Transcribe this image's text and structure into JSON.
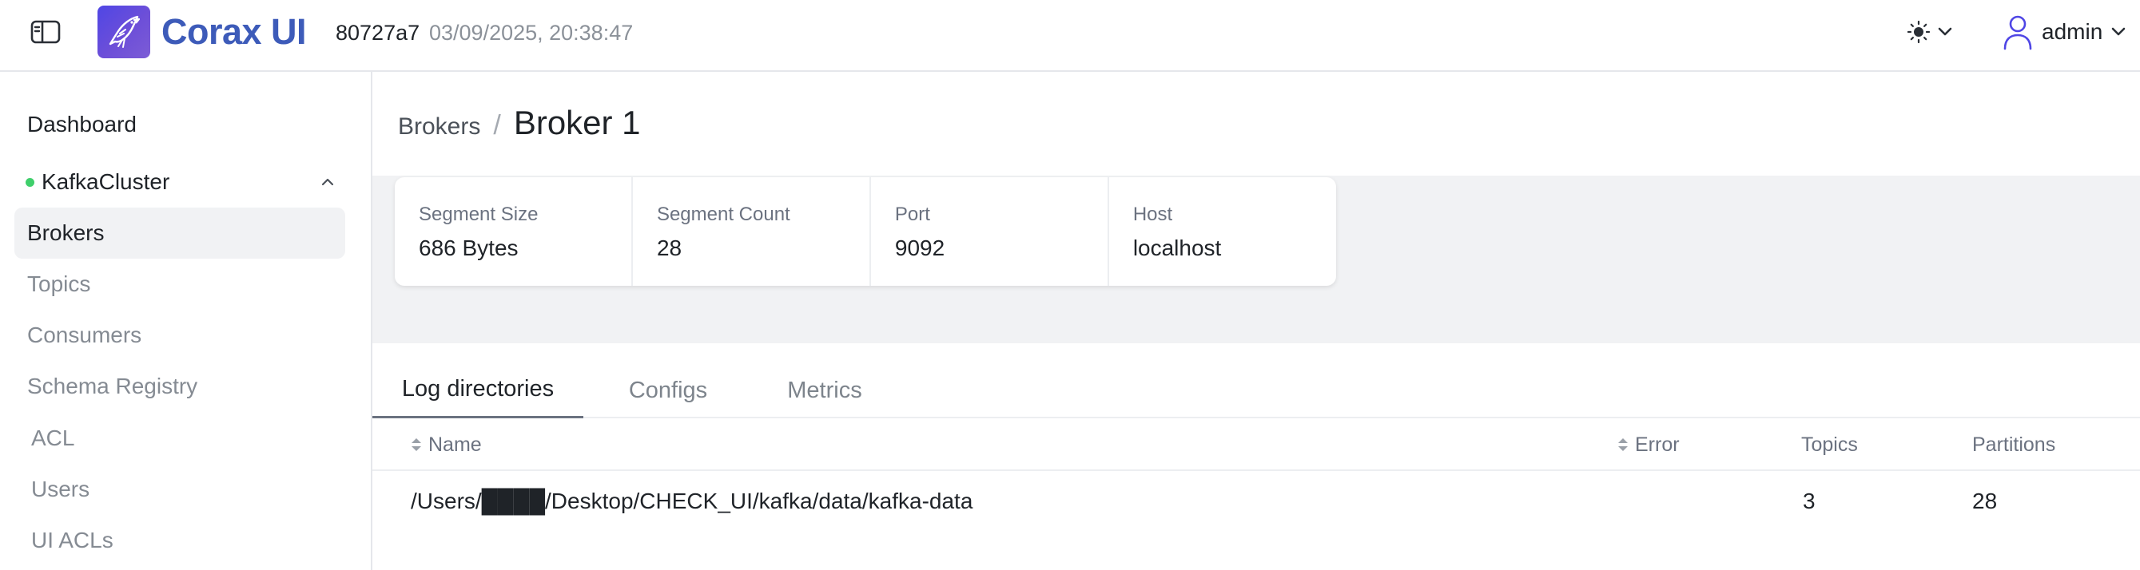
{
  "header": {
    "brand": "Corax UI",
    "build_hash": "80727a7",
    "build_date": "03/09/2025, 20:38:47",
    "user": "admin"
  },
  "sidebar": {
    "dashboard": "Dashboard",
    "cluster": {
      "name": "KafkaCluster",
      "status_color": "#3fcf6b"
    },
    "items": [
      {
        "label": "Brokers",
        "active": true
      },
      {
        "label": "Topics"
      },
      {
        "label": "Consumers"
      },
      {
        "label": "Schema Registry"
      },
      {
        "label": "ACL"
      },
      {
        "label": "Users"
      },
      {
        "label": "UI ACLs"
      }
    ]
  },
  "breadcrumb": {
    "parent": "Brokers",
    "separator": "/",
    "current": "Broker 1"
  },
  "stats": [
    {
      "label": "Segment Size",
      "value": "686 Bytes"
    },
    {
      "label": "Segment Count",
      "value": "28"
    },
    {
      "label": "Port",
      "value": "9092"
    },
    {
      "label": "Host",
      "value": "localhost"
    }
  ],
  "tabs": [
    {
      "label": "Log directories",
      "active": true
    },
    {
      "label": "Configs"
    },
    {
      "label": "Metrics"
    }
  ],
  "table": {
    "columns": [
      "Name",
      "Error",
      "Topics",
      "Partitions"
    ],
    "rows": [
      {
        "name": "/Users/████/Desktop/CHECK_UI/kafka/data/kafka-data",
        "error": "",
        "topics": "3",
        "partitions": "28"
      }
    ]
  },
  "colors": {
    "brand": "#3d5bb9",
    "accent": "#4f46e5"
  }
}
